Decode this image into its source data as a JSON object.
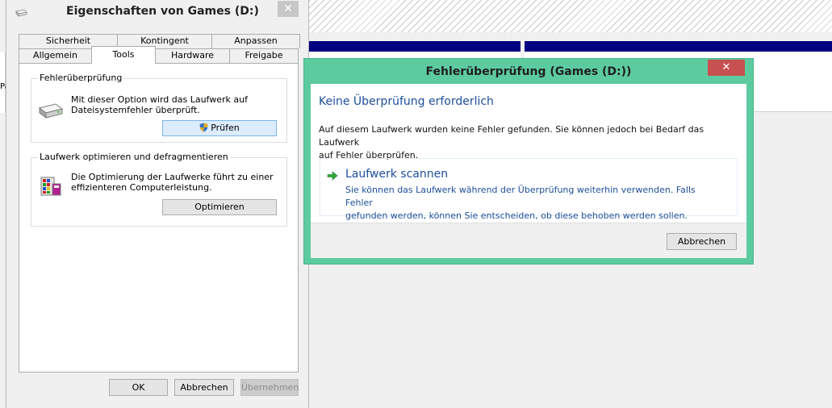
{
  "background": {
    "left_pane_text": "Pa"
  },
  "properties": {
    "title": "Eigenschaften von Games (D:)",
    "close_glyph": "✕",
    "tabs_row1": [
      "Sicherheit",
      "Kontingent",
      "Anpassen"
    ],
    "tabs_row2": [
      "Allgemein",
      "Tools",
      "Hardware",
      "Freigabe"
    ],
    "active_tab": "Tools",
    "check_group": {
      "label": "Fehlerüberprüfung",
      "text_line1": "Mit dieser Option wird das Laufwerk auf",
      "text_line2": "Dateisystemfehler überprüft.",
      "button": "Prüfen"
    },
    "optimize_group": {
      "label": "Laufwerk optimieren und defragmentieren",
      "text_line1": "Die Optimierung der Laufwerke führt zu einer",
      "text_line2": "effizienteren Computerleistung.",
      "button": "Optimieren"
    },
    "footer": {
      "ok": "OK",
      "cancel": "Abbrechen",
      "apply": "Übernehmen"
    }
  },
  "dialog": {
    "title": "Fehlerüberprüfung (Games (D:))",
    "close_glyph": "✕",
    "heading": "Keine Überprüfung erforderlich",
    "text_line1": "Auf diesem Laufwerk wurden keine Fehler gefunden. Sie können jedoch bei Bedarf das Laufwerk",
    "text_line2": "auf Fehler überprüfen.",
    "scan_title": "Laufwerk scannen",
    "scan_desc_line1": "Sie können das Laufwerk während der Überprüfung weiterhin verwenden. Falls Fehler",
    "scan_desc_line2": "gefunden werden, können Sie entscheiden, ob diese behoben werden sollen.",
    "cancel": "Abbrechen"
  },
  "colors": {
    "dialog_frame": "#5dcba0",
    "close_red": "#c75050",
    "link_blue": "#1e4e9a",
    "header_navy": "#000080"
  },
  "icons": [
    "drive-icon",
    "shield-icon",
    "defrag-icon",
    "green-arrow-icon",
    "close-icon"
  ]
}
